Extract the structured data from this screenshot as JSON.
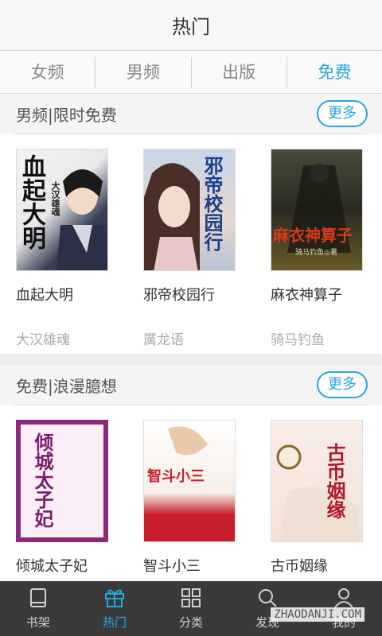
{
  "header": {
    "title": "热门"
  },
  "tabs": [
    {
      "label": "女频"
    },
    {
      "label": "男频"
    },
    {
      "label": "出版"
    },
    {
      "label": "免费"
    }
  ],
  "sections": [
    {
      "title": "男频|限时免费",
      "more_label": "更多",
      "books": [
        {
          "title": "血起大明",
          "author": "大汉雄魂",
          "cover_text": "血起大明",
          "cover_sub": "大汉雄魂"
        },
        {
          "title": "邪帝校园行",
          "author": "厲龙语",
          "cover_text": "邪帝校园行",
          "cover_sub": ""
        },
        {
          "title": "麻衣神算子",
          "author": "骑马钓鱼",
          "cover_text": "麻衣神算子",
          "cover_sub": "骑马钓鱼◎著"
        }
      ]
    },
    {
      "title": "免费|浪漫臆想",
      "more_label": "更多",
      "books": [
        {
          "title": "倾城太子妃",
          "cover_text": "倾城太子妃"
        },
        {
          "title": "智斗小三",
          "cover_text": "智斗小三"
        },
        {
          "title": "古币姻缘",
          "cover_text": "古币姻缘"
        }
      ]
    }
  ],
  "bottom_nav": [
    {
      "label": "书架",
      "icon": "book-icon"
    },
    {
      "label": "热门",
      "icon": "gift-icon"
    },
    {
      "label": "分类",
      "icon": "grid-icon"
    },
    {
      "label": "发现",
      "icon": "search-icon"
    },
    {
      "label": "我的",
      "icon": "user-icon"
    }
  ],
  "watermark": "ZHAODANJI.COM",
  "colors": {
    "accent": "#27a6e1",
    "bottom_bar": "#3a3a3a"
  }
}
